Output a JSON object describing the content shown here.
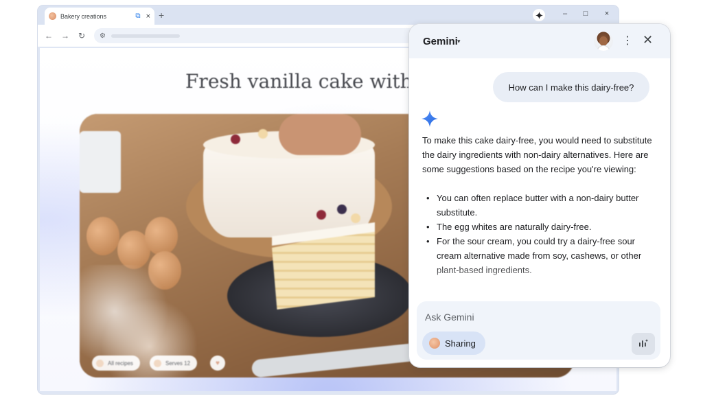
{
  "browser": {
    "tab_title": "Bakery creations",
    "new_tab_glyph": "+",
    "tab_close_glyph": "×",
    "window_buttons": {
      "minimize": "–",
      "maximize": "□",
      "close": "×"
    },
    "nav": {
      "back": "←",
      "forward": "→",
      "reload": "↻"
    }
  },
  "page": {
    "recipe_title": "Fresh vanilla cake with l",
    "chips": [
      "All recipes",
      "Serves 12"
    ]
  },
  "gemini": {
    "title": "Gemini",
    "caret": "▾",
    "more_glyph": "⋮",
    "close_glyph": "✕",
    "user_message": "How can I make this dairy-free?",
    "response_intro": "To make this cake dairy-free, you would need to substitute the dairy ingredients with non-dairy alternatives. Here are some suggestions based on the recipe you're viewing:",
    "response_items": [
      "You can often replace butter with a non-dairy butter substitute.",
      "The egg whites are naturally dairy-free.",
      "For the sour cream, you could try a dairy-free sour cream alternative made from soy, cashews, or other plant-based ingredients."
    ],
    "input_placeholder": "Ask Gemini",
    "sharing_label": "Sharing"
  },
  "colors": {
    "accent": "#1a73e8",
    "panel_header": "#f0f4fa",
    "chip_bg": "#d8e3f6"
  }
}
